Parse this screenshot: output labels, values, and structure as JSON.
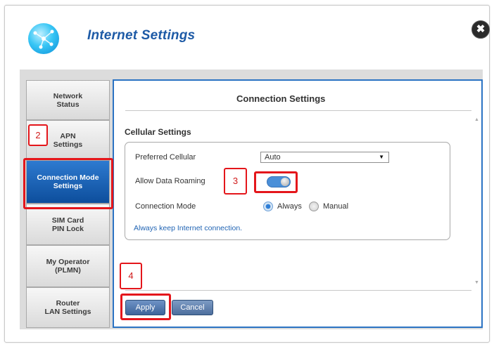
{
  "window": {
    "title": "Internet Settings"
  },
  "icons": {
    "logo": "globe-icon",
    "close": "close-icon",
    "dropdown": "chevron-down-icon"
  },
  "close_glyph": "✖",
  "nav": {
    "items": [
      {
        "label": "Network\nStatus"
      },
      {
        "label": "APN\nSettings"
      },
      {
        "label": "Connection Mode\nSettings",
        "active": true
      },
      {
        "label": "SIM Card\nPIN Lock"
      },
      {
        "label": "My Operator\n(PLMN)"
      },
      {
        "label": "Router\nLAN Settings"
      }
    ]
  },
  "panel": {
    "title": "Connection Settings",
    "section": "Cellular Settings",
    "preferred_cellular": {
      "label": "Preferred Cellular",
      "value": "Auto"
    },
    "data_roaming": {
      "label": "Allow Data Roaming",
      "enabled": true
    },
    "connection_mode": {
      "label": "Connection Mode",
      "options": [
        "Always",
        "Manual"
      ],
      "selected": "Always"
    },
    "hint": "Always keep Internet connection.",
    "buttons": {
      "apply": "Apply",
      "cancel": "Cancel"
    }
  },
  "annotations": {
    "step_apn": "2",
    "step_roaming": "3",
    "step_apply": "4"
  },
  "colors": {
    "accent": "#2b73c3",
    "title": "#1d5aa6",
    "active_nav": "#0d4e9c",
    "highlight": "#e4161b"
  }
}
